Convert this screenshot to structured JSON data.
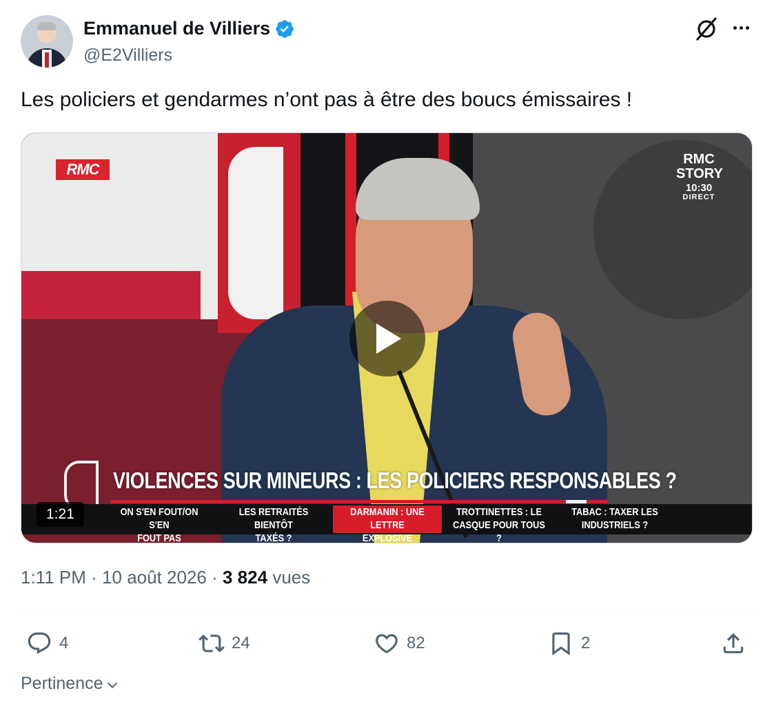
{
  "author": {
    "display_name": "Emmanuel de Villiers",
    "handle": "@E2Villiers",
    "verified_icon": "verified-badge-icon",
    "verified_color": "#1d9bf0"
  },
  "tweet": {
    "text": "Les policiers et gendarmes n’ont pas à être des boucs émissaires !"
  },
  "video": {
    "duration": "1:21",
    "channel_logo": "RMC",
    "story_badge": {
      "line1": "RMC",
      "line2": "STORY",
      "time": "10:30",
      "status": "DIRECT"
    },
    "headline": "VIOLENCES SUR MINEURS : LES POLICIERS RESPONSABLES ?",
    "ticker": [
      {
        "line1": "ON S'EN FOUT/ON S'EN",
        "line2": "FOUT PAS"
      },
      {
        "line1": "LES RETRAITÉS BIENTÔT",
        "line2": "TAXÉS ?"
      },
      {
        "line1": "DARMANIN : UNE LETTRE",
        "line2": "EXPLOSIVE"
      },
      {
        "line1": "TROTTINETTES : LE",
        "line2": "CASQUE POUR TOUS ?"
      },
      {
        "line1": "TABAC : TAXER LES",
        "line2": "INDUSTRIELS ?"
      }
    ],
    "accent_color": "#d71d2a"
  },
  "meta": {
    "time": "1:11 PM",
    "separator": "·",
    "date": "10 août 2026",
    "views_count": "3 824",
    "views_label": "vues"
  },
  "actions": {
    "replies": "4",
    "reposts": "24",
    "likes": "82",
    "bookmarks": "2"
  },
  "sort": {
    "label": "Pertinence"
  }
}
